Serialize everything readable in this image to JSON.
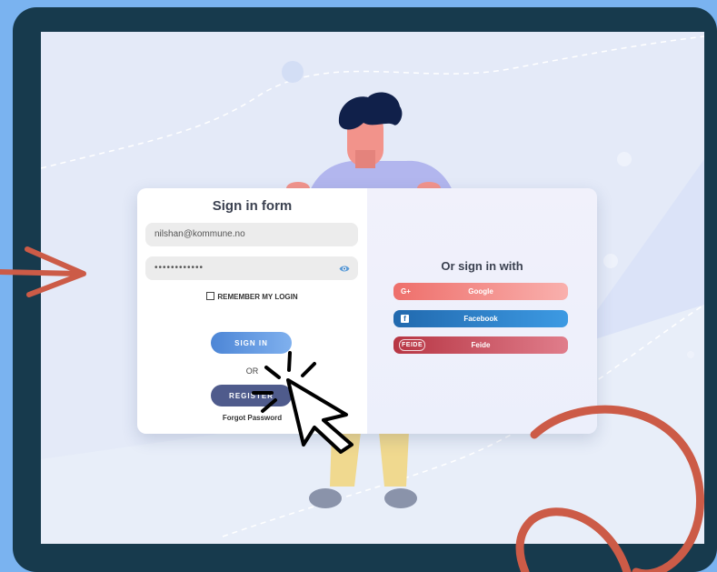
{
  "colors": {
    "frame": "#173a4d",
    "screen": "#e4eaf8",
    "page_background": "#7ab3f0",
    "arrow_annotation": "#cc5b47",
    "sign_in_button": "#4d86d6",
    "register_button": "#4f5b8c",
    "google": "#ee6f6b",
    "facebook": "#2169ae",
    "feide": "#b73644"
  },
  "login_form": {
    "title": "Sign in form",
    "email_value": "nilshan@kommune.no",
    "password_value": "••••••••••••",
    "remember_label": "REMEMBER MY LOGIN",
    "sign_in_label": "SIGN IN",
    "or_label": "OR",
    "register_label": "REGISTER",
    "forgot_label": "Forgot Password"
  },
  "social_login": {
    "title": "Or sign in with",
    "buttons": [
      {
        "label": "Google",
        "icon": "google-plus-icon",
        "icon_text": "G+"
      },
      {
        "label": "Facebook",
        "icon": "facebook-icon",
        "icon_text": "f"
      },
      {
        "label": "Feide",
        "icon": "feide-logo-icon",
        "icon_text": "FEIDE"
      }
    ]
  },
  "decorations": {
    "illustration": "person-holding-login-card",
    "pointer": "click-cursor-icon",
    "left_arrow": "arrow-right-icon",
    "scribble": "scribble-loop"
  }
}
